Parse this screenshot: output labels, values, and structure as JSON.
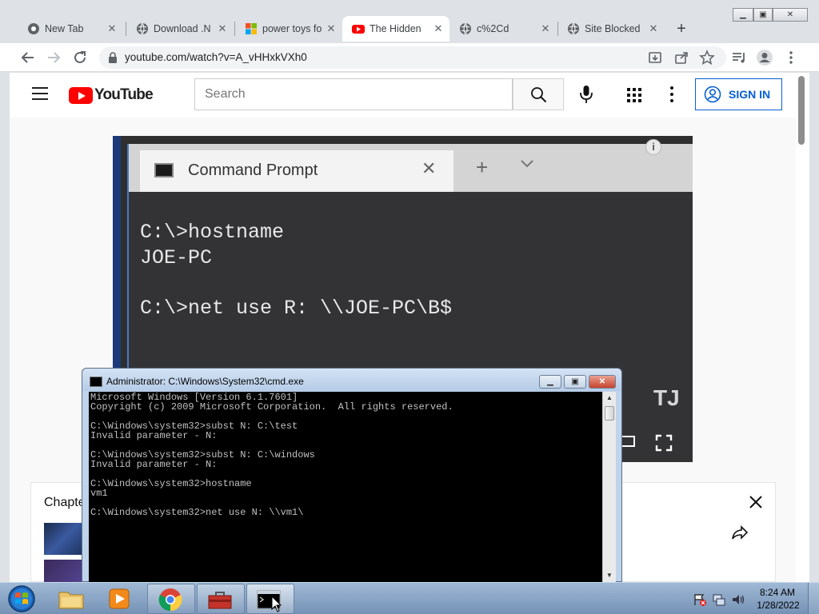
{
  "browser": {
    "tabs": [
      {
        "title": "New Tab",
        "favicon": "chrome-icon"
      },
      {
        "title": "Download .N",
        "favicon": "globe-icon"
      },
      {
        "title": "power toys fo",
        "favicon": "microsoft-icon"
      },
      {
        "title": "The Hidden",
        "favicon": "youtube-icon"
      },
      {
        "title": "c%2Cd",
        "favicon": "globe-icon"
      },
      {
        "title": "Site Blocked",
        "favicon": "globe-icon"
      }
    ],
    "url": "youtube.com/watch?v=A_vHHxkVXh0"
  },
  "youtube": {
    "logo_text": "YouTube",
    "search_placeholder": "Search",
    "sign_in_label": "SIGN IN",
    "chapters_label": "Chapte"
  },
  "video": {
    "tab_title": "Command Prompt",
    "lines": [
      "C:\\>hostname",
      "JOE-PC",
      "",
      "C:\\>net use R: \\\\JOE-PC\\B$"
    ],
    "channel_badge": "TJ"
  },
  "cmd": {
    "title": "Administrator: C:\\Windows\\System32\\cmd.exe",
    "output": "Microsoft Windows [Version 6.1.7601]\nCopyright (c) 2009 Microsoft Corporation.  All rights reserved.\n\nC:\\Windows\\system32>subst N: C:\\test\nInvalid parameter - N:\n\nC:\\Windows\\system32>subst N: C:\\windows\nInvalid parameter - N:\n\nC:\\Windows\\system32>hostname\nvm1\n\nC:\\Windows\\system32>net use N: \\\\vm1\\"
  },
  "taskbar": {
    "items": [
      "windows-explorer",
      "windows-media-player",
      "google-chrome",
      "toolbox-app",
      "command-prompt"
    ],
    "clock_time": "8:24 AM",
    "clock_date": "1/28/2022"
  },
  "colors": {
    "youtube_red": "#ff0000",
    "sign_in_blue": "#065fd4",
    "chrome_frame": "#dee1e6",
    "console_text": "#c0c0c0"
  }
}
